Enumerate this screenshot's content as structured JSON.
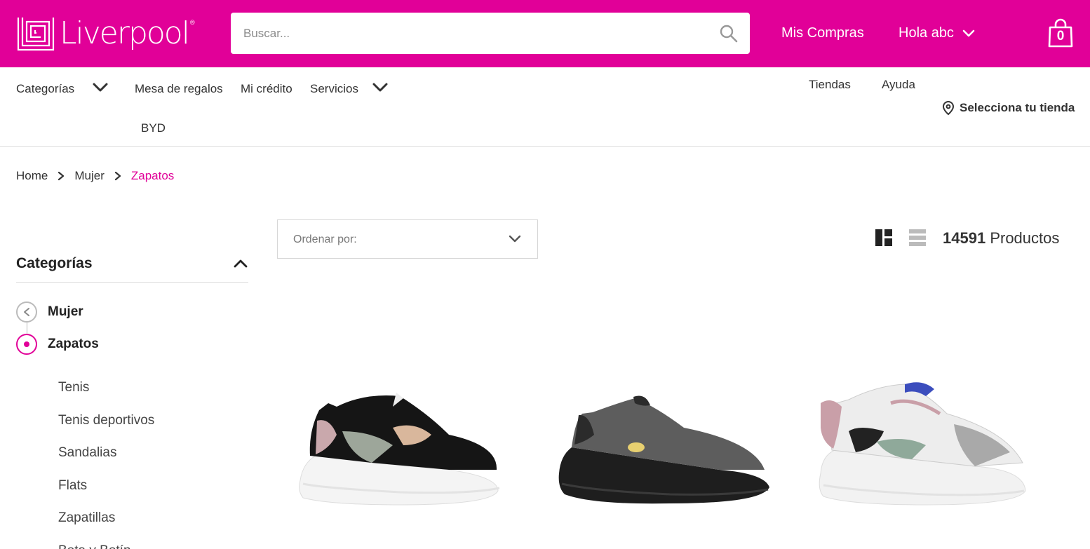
{
  "header": {
    "logo_text": "Liverpool",
    "logo_reg": "®",
    "search_placeholder": "Buscar...",
    "mis_compras": "Mis Compras",
    "greeting": "Hola abc",
    "cart_count": "0"
  },
  "nav": {
    "categorias": "Categorías",
    "mesa_regalos": "Mesa de regalos",
    "mi_credito": "Mi crédito",
    "servicios": "Servicios",
    "byd": "BYD",
    "tiendas": "Tiendas",
    "ayuda": "Ayuda",
    "store_selector": "Selecciona tu tienda"
  },
  "breadcrumb": [
    "Home",
    "Mujer",
    "Zapatos"
  ],
  "sidebar": {
    "title": "Categorías",
    "parent": "Mujer",
    "current": "Zapatos",
    "items": [
      "Tenis",
      "Tenis deportivos",
      "Sandalias",
      "Flats",
      "Zapatillas",
      "Bota y Botín"
    ]
  },
  "toolbar": {
    "sort_placeholder": "Ordenar por:",
    "count_number": "14591",
    "count_label": "Productos"
  },
  "products": [
    {
      "name": "sneaker-black-chunky"
    },
    {
      "name": "sneaker-gray-black"
    },
    {
      "name": "sneaker-white-pastel"
    }
  ],
  "colors": {
    "brand": "#e10098",
    "text": "#333333"
  }
}
